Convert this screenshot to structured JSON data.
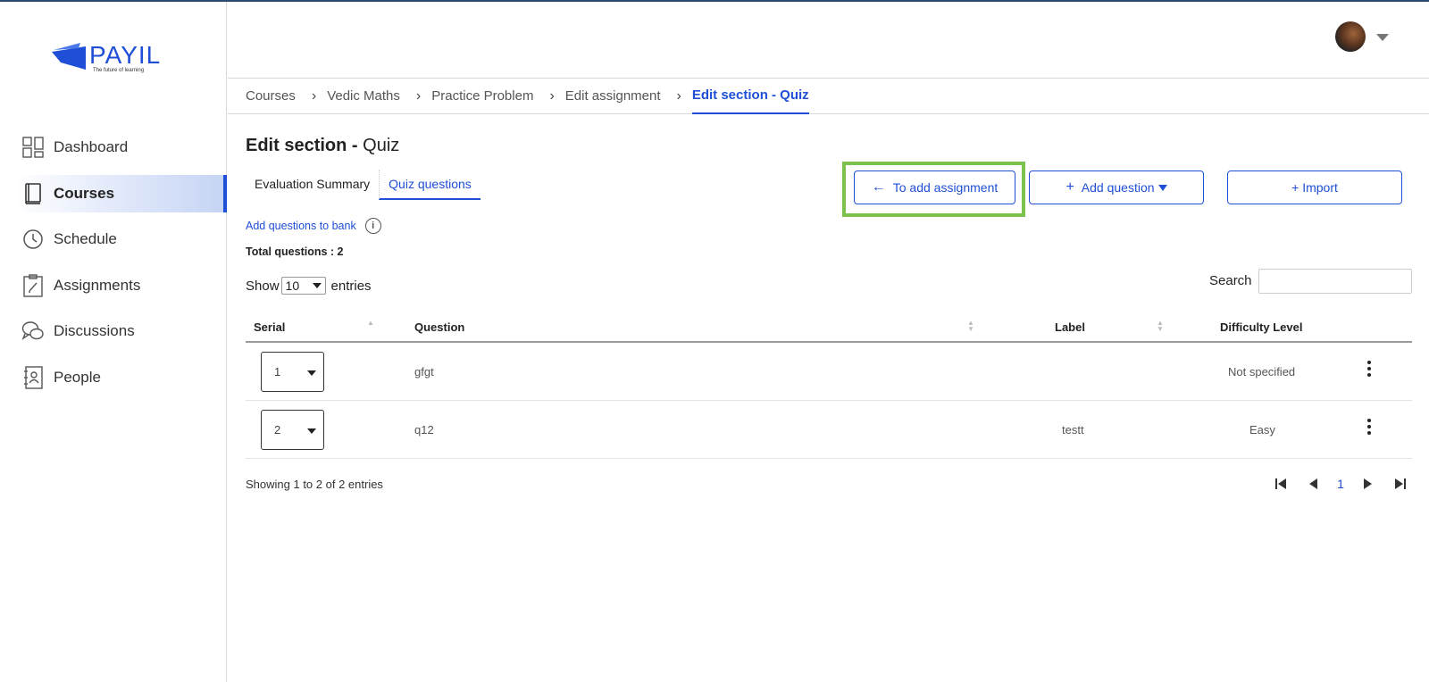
{
  "brand": {
    "name": "PAYIL",
    "tagline": "The future of learning"
  },
  "sidebar": {
    "items": [
      {
        "label": "Dashboard",
        "icon": "dashboard-icon"
      },
      {
        "label": "Courses",
        "icon": "book-icon",
        "active": true
      },
      {
        "label": "Schedule",
        "icon": "clock-icon"
      },
      {
        "label": "Assignments",
        "icon": "clipboard-icon"
      },
      {
        "label": "Discussions",
        "icon": "chat-icon"
      },
      {
        "label": "People",
        "icon": "contacts-icon"
      }
    ]
  },
  "breadcrumb": [
    "Courses",
    "Vedic Maths",
    "Practice Problem",
    "Edit assignment",
    "Edit section -  Quiz"
  ],
  "page": {
    "title_bold": "Edit section -",
    "title_rest": " Quiz"
  },
  "tabs": [
    "Evaluation Summary",
    "Quiz questions"
  ],
  "buttons": {
    "to_assignment": "To add assignment",
    "add_question": "Add question",
    "import": "+ Import"
  },
  "bank_link": "Add questions to bank",
  "total_questions": "Total questions : 2",
  "entries": {
    "show": "Show",
    "value": "10",
    "suffix": "entries"
  },
  "search": {
    "label": "Search",
    "placeholder": ""
  },
  "table": {
    "columns": [
      "Serial",
      "Question",
      "Label",
      "Difficulty Level"
    ],
    "rows": [
      {
        "serial": "1",
        "question": "gfgt",
        "label": "",
        "difficulty": "Not specified"
      },
      {
        "serial": "2",
        "question": "q12",
        "label": "testt",
        "difficulty": "Easy"
      }
    ]
  },
  "footer": {
    "showing": "Showing 1 to 2 of 2 entries",
    "page": "1"
  },
  "colors": {
    "accent": "#1f4fd6",
    "highlight": "#7bc24e"
  }
}
